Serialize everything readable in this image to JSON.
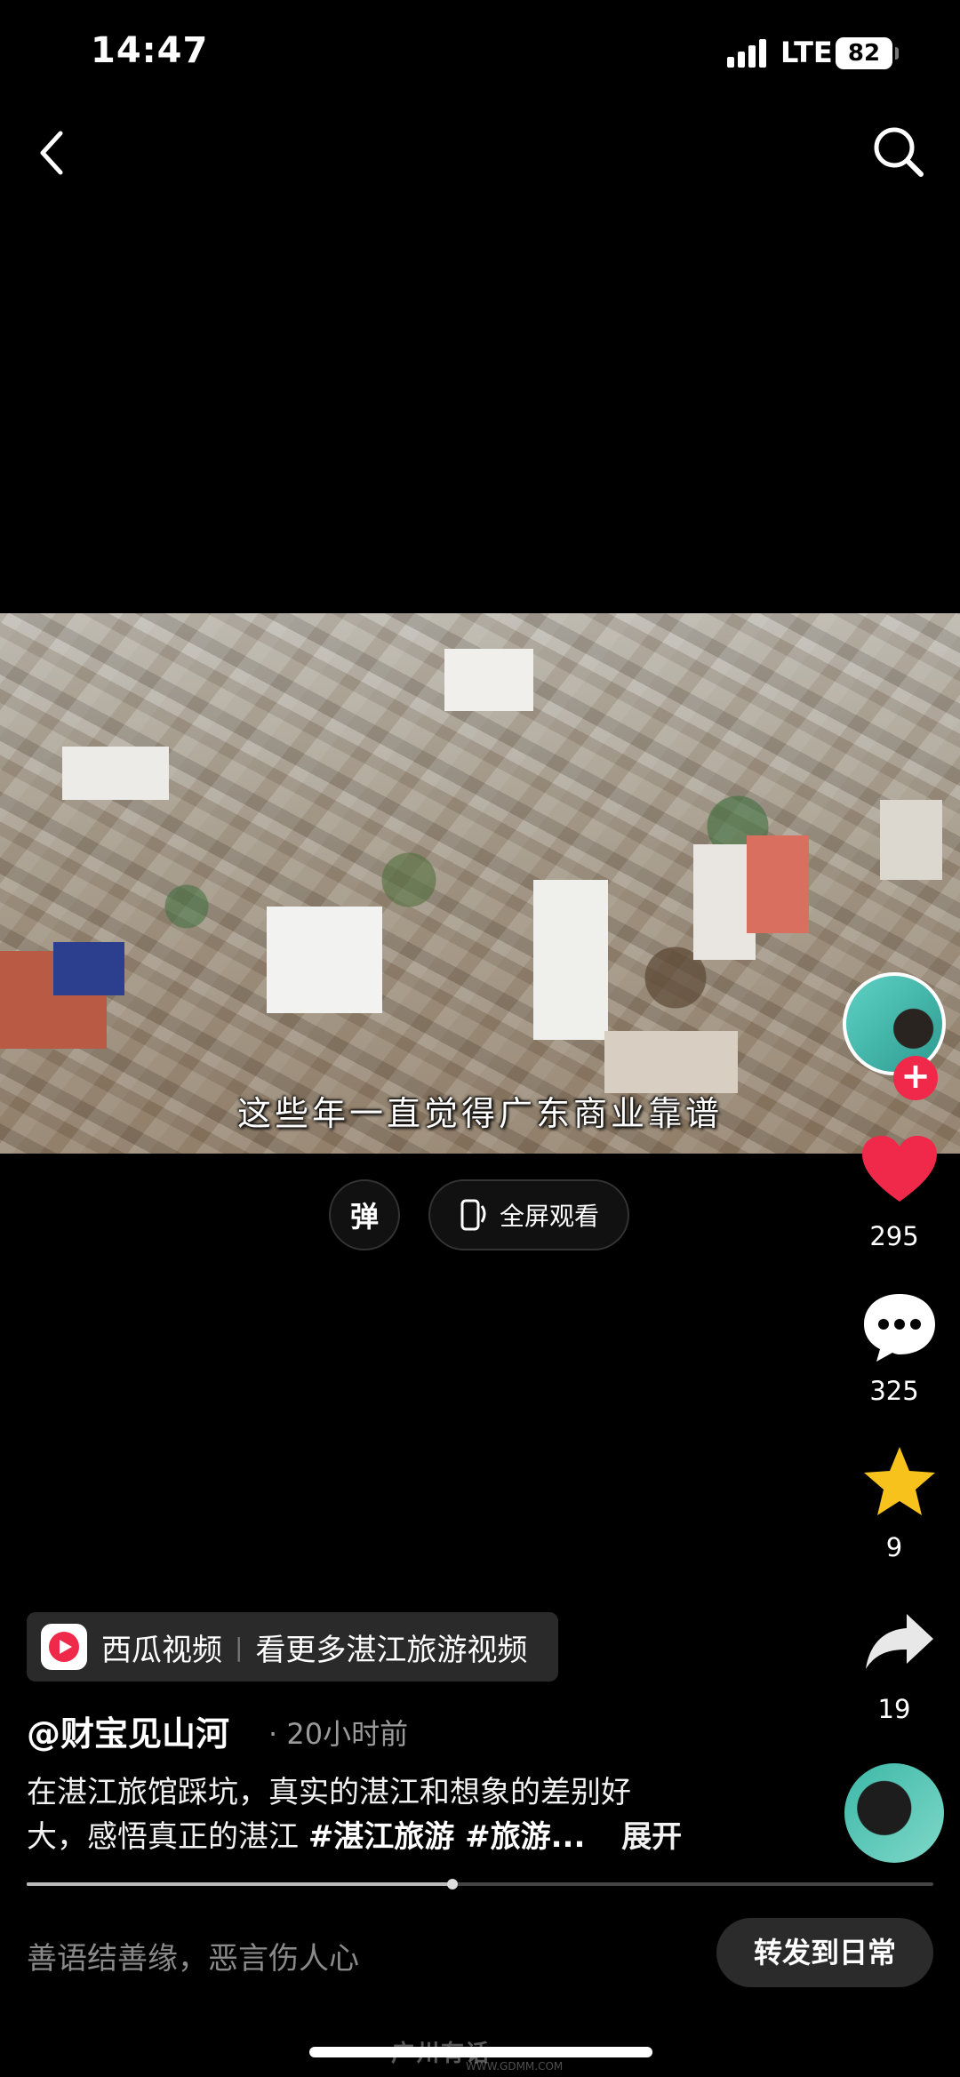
{
  "status_bar": {
    "time": "14:47",
    "network": "LTE",
    "battery": "82"
  },
  "nav": {
    "back_icon": "chevron-left-icon",
    "search_icon": "search-icon"
  },
  "video": {
    "subtitle": "这些年一直觉得广东商业靠谱",
    "progress_fraction": 0.47
  },
  "controls": {
    "danmu_label": "弹",
    "fullscreen_label": "全屏观看"
  },
  "actions": {
    "likes": "295",
    "comments": "325",
    "favorites": "9",
    "shares": "19",
    "like_color": "#f0284a",
    "favorite_color": "#f7c21b"
  },
  "promo": {
    "app_name": "西瓜视频",
    "cta": "看更多湛江旅游视频"
  },
  "post": {
    "author": "@财宝见山河",
    "time_ago": "· 20小时前",
    "description_line1": "在湛江旅馆踩坑，真实的湛江和想象的差别好",
    "description_line2": "大，感悟真正的湛江",
    "hashtags": "#湛江旅游 #旅游...",
    "expand_label": "展开"
  },
  "comment_bar": {
    "placeholder": "善语结善缘，恶言伤人心",
    "repost_label": "转发到日常"
  },
  "watermark": {
    "text": "广州有话",
    "url": "WWW.GDMM.COM"
  }
}
